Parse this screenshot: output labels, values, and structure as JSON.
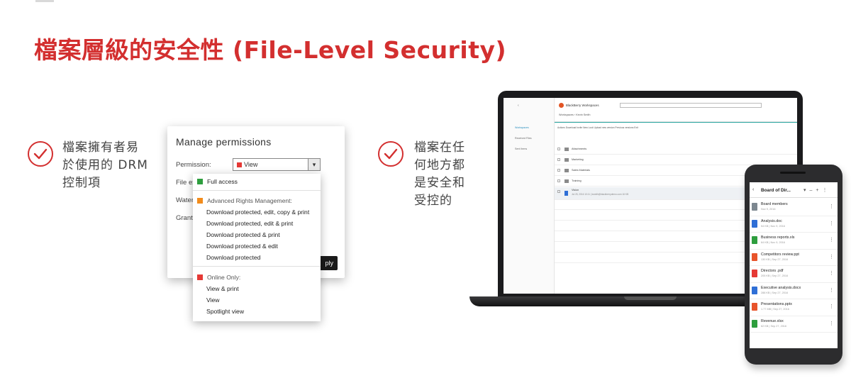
{
  "slide": {
    "title": "檔案層級的安全性 (File-Level Security)",
    "accent_color": "#d32f2f"
  },
  "bullets": [
    {
      "icon": "check-circle-icon",
      "lines": [
        "檔案擁有者易",
        "於使用的 DRM",
        "控制項"
      ]
    },
    {
      "icon": "check-circle-icon",
      "lines": [
        "檔案在任",
        "何地方都",
        "是安全和",
        "受控的"
      ]
    }
  ],
  "dialog": {
    "title": "Manage permissions",
    "permission_label": "Permission:",
    "permission_value": "View",
    "file_exp_label": "File ex",
    "watermark_label": "Water",
    "grant_label": "Grant",
    "apply_label": "ply"
  },
  "menu": {
    "full_access": "Full access",
    "arm_group": "Advanced Rights Management:",
    "arm_items": [
      "Download protected, edit, copy & print",
      "Download protected, edit & print",
      "Download protected & print",
      "Download protected & edit",
      "Download protected"
    ],
    "online_group": "Online Only:",
    "online_items": [
      "View & print",
      "View",
      "Spotlight view"
    ],
    "colors": {
      "full": "#2e9e3e",
      "arm": "#f28c1c",
      "online": "#e53935"
    }
  },
  "laptop": {
    "app_name": "BlackBerry Workspaces",
    "breadcrumb": "Workspaces  ›  Kevin Smith",
    "sidebar_items": [
      "Workspaces",
      "Received Files",
      "Sent Items"
    ],
    "toolbar": "Actions   Download   Invite   New   Lock   Upload new version   Previous versions   Exit",
    "rows": [
      "Attachments",
      "Marketing",
      "Sales Materials",
      "Training"
    ],
    "selected_row": "Vision",
    "selected_meta": "Jul 25, 2016 10:11 | ksmith@blackberrydemo.com 16 KB"
  },
  "phone": {
    "title": "Board of Dir...",
    "files": [
      {
        "name": "Board members",
        "meta": "Nov 9, 2016",
        "color": "#7d8790"
      },
      {
        "name": "Analysis.doc",
        "meta": "54 KB | Nov 9, 2016",
        "color": "#2f6fd6"
      },
      {
        "name": "Business reports.xls",
        "meta": "64 KB | Nov 9, 2016",
        "color": "#2e9e3e"
      },
      {
        "name": "Competitors review.ppt",
        "meta": "130 KB | Sep 27, 2016",
        "color": "#e8542b"
      },
      {
        "name": "Directors .pdf",
        "meta": "205 KB | Sep 27, 2016",
        "color": "#e53935"
      },
      {
        "name": "Executive analysis.docx",
        "meta": "288 KB | Sep 27, 2016",
        "color": "#2f6fd6"
      },
      {
        "name": "Presentations.pptx",
        "meta": "1.77 MB | Sep 27, 2016",
        "color": "#e8542b"
      },
      {
        "name": "Revenue.xlsx",
        "meta": "62 KB | Sep 27, 2016",
        "color": "#2e9e3e"
      }
    ]
  }
}
